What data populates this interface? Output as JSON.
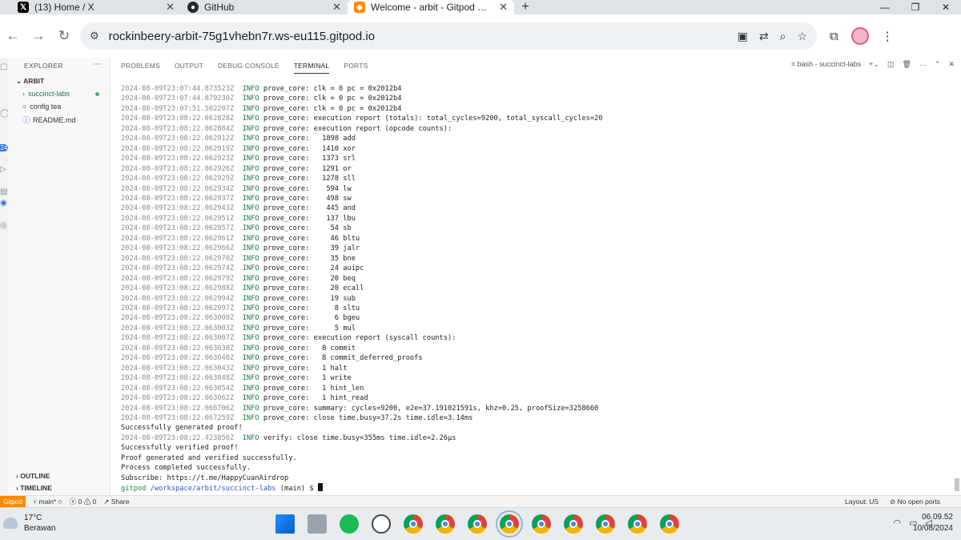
{
  "browser": {
    "tabs": [
      {
        "label": "(13) Home / X",
        "icon": "x-logo-icon",
        "active": false
      },
      {
        "label": "GitHub",
        "icon": "github-icon",
        "active": false
      },
      {
        "label": "Welcome - arbit - Gitpod Code",
        "icon": "gitpod-icon",
        "active": true
      }
    ],
    "new_tab": "+",
    "url": "rockinbeery-arbit-75g1vhebn7r.ws-eu115.gitpod.io"
  },
  "sidebar": {
    "header": "EXPLORER",
    "section": "ARBIT",
    "items": [
      {
        "label": "succinct-labs",
        "type": "folder"
      },
      {
        "label": "config tea",
        "type": "file"
      },
      {
        "label": "README.md",
        "type": "file"
      }
    ],
    "outline": "OUTLINE",
    "timeline": "TIMELINE",
    "badge_count": "24"
  },
  "panel": {
    "tabs": [
      "PROBLEMS",
      "OUTPUT",
      "DEBUG CONSOLE",
      "TERMINAL",
      "PORTS"
    ],
    "active_tab": "TERMINAL",
    "terminal_name": "bash - succinct-labs"
  },
  "terminal": {
    "log_lines": [
      {
        "ts": "2024-08-09T23:07:44.873523Z",
        "level": "INFO",
        "target": "prove_core:",
        "msg": "clk = 0 pc = 0x2012b4"
      },
      {
        "ts": "2024-08-09T23:07:44.879230Z",
        "level": "INFO",
        "target": "prove_core:",
        "msg": "clk = 0 pc = 0x2012b4"
      },
      {
        "ts": "2024-08-09T23:07:51.502207Z",
        "level": "INFO",
        "target": "prove_core:",
        "msg": "clk = 0 pc = 0x2012b4"
      },
      {
        "ts": "2024-08-09T23:08:22.062828Z",
        "level": "INFO",
        "target": "prove_core:",
        "msg": "execution report (totals): total_cycles=9200, total_syscall_cycles=20"
      },
      {
        "ts": "2024-08-09T23:08:22.062884Z",
        "level": "INFO",
        "target": "prove_core:",
        "msg": "execution report (opcode counts):"
      },
      {
        "ts": "2024-08-09T23:08:22.062912Z",
        "level": "INFO",
        "target": "prove_core:",
        "msg": "  1898 add"
      },
      {
        "ts": "2024-08-09T23:08:22.062919Z",
        "level": "INFO",
        "target": "prove_core:",
        "msg": "  1410 xor"
      },
      {
        "ts": "2024-08-09T23:08:22.062923Z",
        "level": "INFO",
        "target": "prove_core:",
        "msg": "  1373 srl"
      },
      {
        "ts": "2024-08-09T23:08:22.062926Z",
        "level": "INFO",
        "target": "prove_core:",
        "msg": "  1291 or"
      },
      {
        "ts": "2024-08-09T23:08:22.062929Z",
        "level": "INFO",
        "target": "prove_core:",
        "msg": "  1278 sll"
      },
      {
        "ts": "2024-08-09T23:08:22.062934Z",
        "level": "INFO",
        "target": "prove_core:",
        "msg": "   594 lw"
      },
      {
        "ts": "2024-08-09T23:08:22.062937Z",
        "level": "INFO",
        "target": "prove_core:",
        "msg": "   498 sw"
      },
      {
        "ts": "2024-08-09T23:08:22.062943Z",
        "level": "INFO",
        "target": "prove_core:",
        "msg": "   445 and"
      },
      {
        "ts": "2024-08-09T23:08:22.062951Z",
        "level": "INFO",
        "target": "prove_core:",
        "msg": "   137 lbu"
      },
      {
        "ts": "2024-08-09T23:08:22.062957Z",
        "level": "INFO",
        "target": "prove_core:",
        "msg": "    54 sb"
      },
      {
        "ts": "2024-08-09T23:08:22.062961Z",
        "level": "INFO",
        "target": "prove_core:",
        "msg": "    46 bltu"
      },
      {
        "ts": "2024-08-09T23:08:22.062966Z",
        "level": "INFO",
        "target": "prove_core:",
        "msg": "    39 jalr"
      },
      {
        "ts": "2024-08-09T23:08:22.062970Z",
        "level": "INFO",
        "target": "prove_core:",
        "msg": "    35 bne"
      },
      {
        "ts": "2024-08-09T23:08:22.062974Z",
        "level": "INFO",
        "target": "prove_core:",
        "msg": "    24 auipc"
      },
      {
        "ts": "2024-08-09T23:08:22.062979Z",
        "level": "INFO",
        "target": "prove_core:",
        "msg": "    20 beq"
      },
      {
        "ts": "2024-08-09T23:08:22.062988Z",
        "level": "INFO",
        "target": "prove_core:",
        "msg": "    20 ecall"
      },
      {
        "ts": "2024-08-09T23:08:22.062994Z",
        "level": "INFO",
        "target": "prove_core:",
        "msg": "    19 sub"
      },
      {
        "ts": "2024-08-09T23:08:22.062997Z",
        "level": "INFO",
        "target": "prove_core:",
        "msg": "     8 sltu"
      },
      {
        "ts": "2024-08-09T23:08:22.063000Z",
        "level": "INFO",
        "target": "prove_core:",
        "msg": "     6 bgeu"
      },
      {
        "ts": "2024-08-09T23:08:22.063003Z",
        "level": "INFO",
        "target": "prove_core:",
        "msg": "     5 mul"
      },
      {
        "ts": "2024-08-09T23:08:22.063007Z",
        "level": "INFO",
        "target": "prove_core:",
        "msg": "execution report (syscall counts):"
      },
      {
        "ts": "2024-08-09T23:08:22.063030Z",
        "level": "INFO",
        "target": "prove_core:",
        "msg": "  8 commit"
      },
      {
        "ts": "2024-08-09T23:08:22.063040Z",
        "level": "INFO",
        "target": "prove_core:",
        "msg": "  8 commit_deferred_proofs"
      },
      {
        "ts": "2024-08-09T23:08:22.063043Z",
        "level": "INFO",
        "target": "prove_core:",
        "msg": "  1 halt"
      },
      {
        "ts": "2024-08-09T23:08:22.063048Z",
        "level": "INFO",
        "target": "prove_core:",
        "msg": "  1 write"
      },
      {
        "ts": "2024-08-09T23:08:22.063054Z",
        "level": "INFO",
        "target": "prove_core:",
        "msg": "  1 hint_len"
      },
      {
        "ts": "2024-08-09T23:08:22.063062Z",
        "level": "INFO",
        "target": "prove_core:",
        "msg": "  1 hint_read"
      },
      {
        "ts": "2024-08-09T23:08:22.066706Z",
        "level": "INFO",
        "target": "prove_core:",
        "msg": "summary: cycles=9200, e2e=37.191021591s, khz=0.25, proofSize=3258660"
      },
      {
        "ts": "2024-08-09T23:08:22.067259Z",
        "level": "INFO",
        "target": "prove_core:",
        "msg": "close time.busy=37.2s time.idle=3.14ms"
      }
    ],
    "generated_line": "Successfully generated proof!",
    "verify_line": {
      "ts": "2024-08-09T23:08:22.423856Z",
      "level": "INFO",
      "target": "verify:",
      "msg": "close time.busy=355ms time.idle=2.26µs"
    },
    "tail_lines": [
      "Successfully verified proof!",
      "Proof generated and verified successfully.",
      "Process completed successfully.",
      "Subscribe: https://t.me/HappyCuanAirdrop"
    ],
    "prompt": {
      "user": "gitpod",
      "path": "/workspace/arbit/succinct-labs",
      "branch": "(main) $"
    }
  },
  "statusbar": {
    "remote": "Gitpod",
    "branch": "main*",
    "problems": "0 ⚠ 0",
    "share": "Share",
    "layout": "Layout: US",
    "ports": "No open ports"
  },
  "taskbar": {
    "temp": "17°C",
    "weather": "Berawan",
    "time": "06.09.52",
    "date": "10/08/2024"
  },
  "colors": {
    "remote_orange": "#ff8a00",
    "log_info_green": "#157a3a",
    "prompt_green": "#1c8a3e",
    "prompt_blue": "#2757b8"
  }
}
